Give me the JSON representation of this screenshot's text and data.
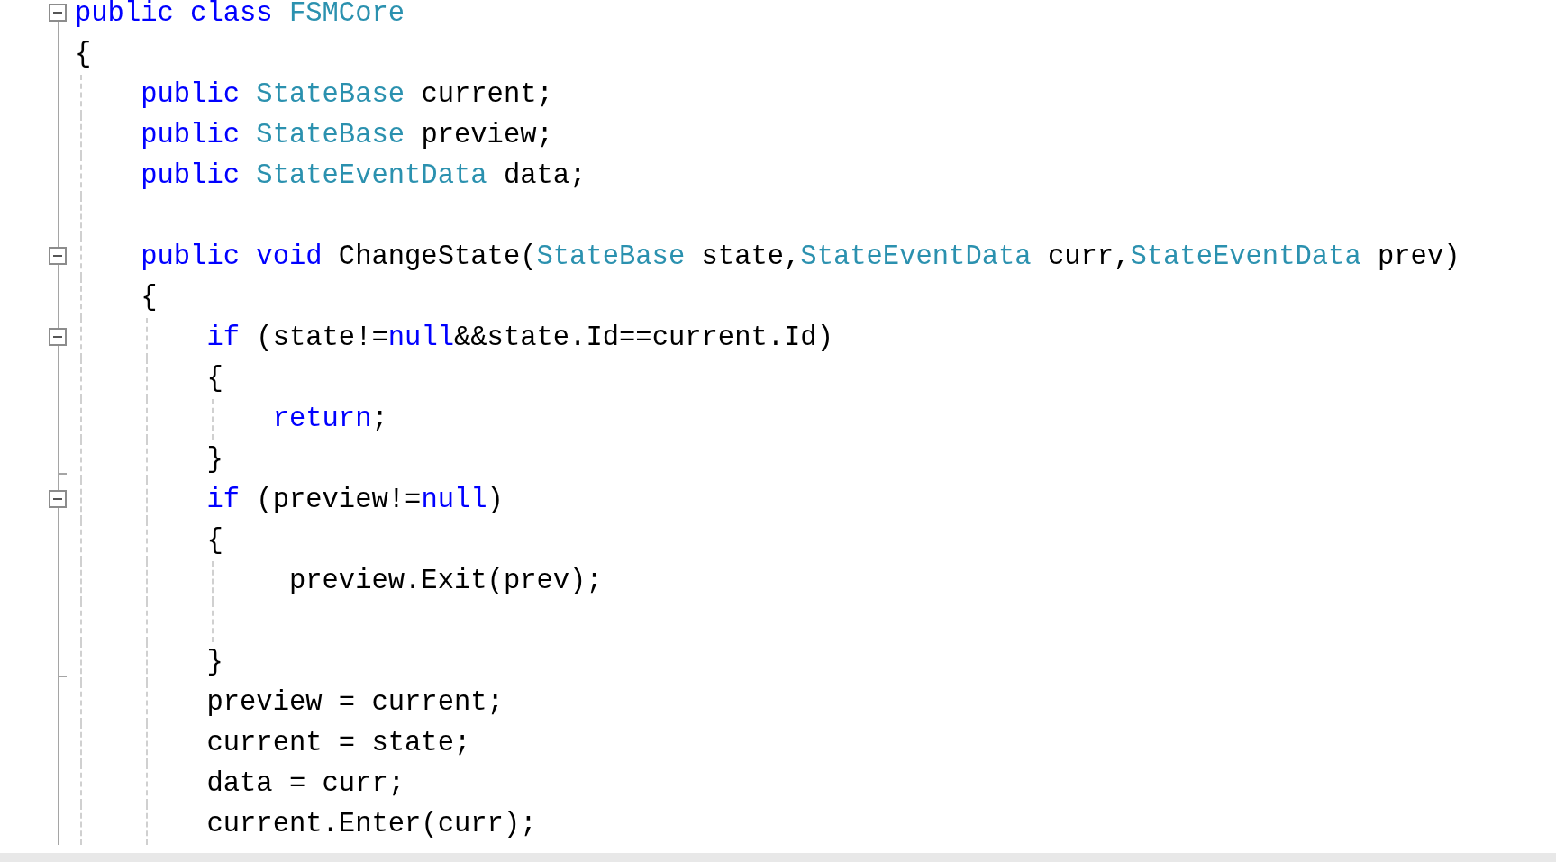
{
  "editor": {
    "lines": [
      {
        "tokens": [
          {
            "kind": "keyword",
            "text": "public class "
          },
          {
            "kind": "type",
            "text": "FSMCore"
          }
        ],
        "expanded": true
      },
      {
        "tokens": [
          {
            "kind": "plain",
            "text": "{"
          }
        ]
      },
      {
        "tokens": [
          {
            "kind": "keyword",
            "text": "    public "
          },
          {
            "kind": "type",
            "text": "StateBase"
          },
          {
            "kind": "plain",
            "text": " current;"
          }
        ]
      },
      {
        "tokens": [
          {
            "kind": "keyword",
            "text": "    public "
          },
          {
            "kind": "type",
            "text": "StateBase"
          },
          {
            "kind": "plain",
            "text": " preview;"
          }
        ]
      },
      {
        "tokens": [
          {
            "kind": "keyword",
            "text": "    public "
          },
          {
            "kind": "type",
            "text": "StateEventData"
          },
          {
            "kind": "plain",
            "text": " data;"
          }
        ]
      },
      {
        "kind": "blank"
      },
      {
        "tokens": [
          {
            "kind": "keyword",
            "text": "    public void "
          },
          {
            "kind": "plain",
            "text": "ChangeState("
          },
          {
            "kind": "type",
            "text": "StateBase"
          },
          {
            "kind": "plain",
            "text": " state,"
          },
          {
            "kind": "type",
            "text": "StateEventData"
          },
          {
            "kind": "plain",
            "text": " curr,"
          },
          {
            "kind": "type",
            "text": "StateEventData"
          },
          {
            "kind": "plain",
            "text": " prev)"
          }
        ],
        "expanded": true
      },
      {
        "tokens": [
          {
            "kind": "plain",
            "text": "    {"
          }
        ]
      },
      {
        "tokens": [
          {
            "kind": "keyword",
            "text": "        if "
          },
          {
            "kind": "plain",
            "text": "(state!="
          },
          {
            "kind": "keyword",
            "text": "null"
          },
          {
            "kind": "plain",
            "text": "&&state.Id==current.Id)"
          }
        ],
        "expanded": true
      },
      {
        "tokens": [
          {
            "kind": "plain",
            "text": "        {"
          }
        ]
      },
      {
        "tokens": [
          {
            "kind": "keyword",
            "text": "            return"
          },
          {
            "kind": "plain",
            "text": ";"
          }
        ]
      },
      {
        "tokens": [
          {
            "kind": "plain",
            "text": "        }"
          }
        ],
        "block_end": true
      },
      {
        "tokens": [
          {
            "kind": "keyword",
            "text": "        if "
          },
          {
            "kind": "plain",
            "text": "(preview!="
          },
          {
            "kind": "keyword",
            "text": "null"
          },
          {
            "kind": "plain",
            "text": ")"
          }
        ],
        "expanded": true
      },
      {
        "tokens": [
          {
            "kind": "plain",
            "text": "        {"
          }
        ]
      },
      {
        "tokens": [
          {
            "kind": "plain",
            "text": "             preview.Exit(prev);"
          }
        ]
      },
      {
        "kind": "blank"
      },
      {
        "tokens": [
          {
            "kind": "plain",
            "text": "        }"
          }
        ],
        "block_end": true
      },
      {
        "tokens": [
          {
            "kind": "plain",
            "text": "        preview = current;"
          }
        ]
      },
      {
        "tokens": [
          {
            "kind": "plain",
            "text": "        current = state;"
          }
        ]
      },
      {
        "tokens": [
          {
            "kind": "plain",
            "text": "        data = curr;"
          }
        ]
      },
      {
        "tokens": [
          {
            "kind": "plain",
            "text": "        current.Enter(curr);"
          }
        ]
      }
    ]
  }
}
